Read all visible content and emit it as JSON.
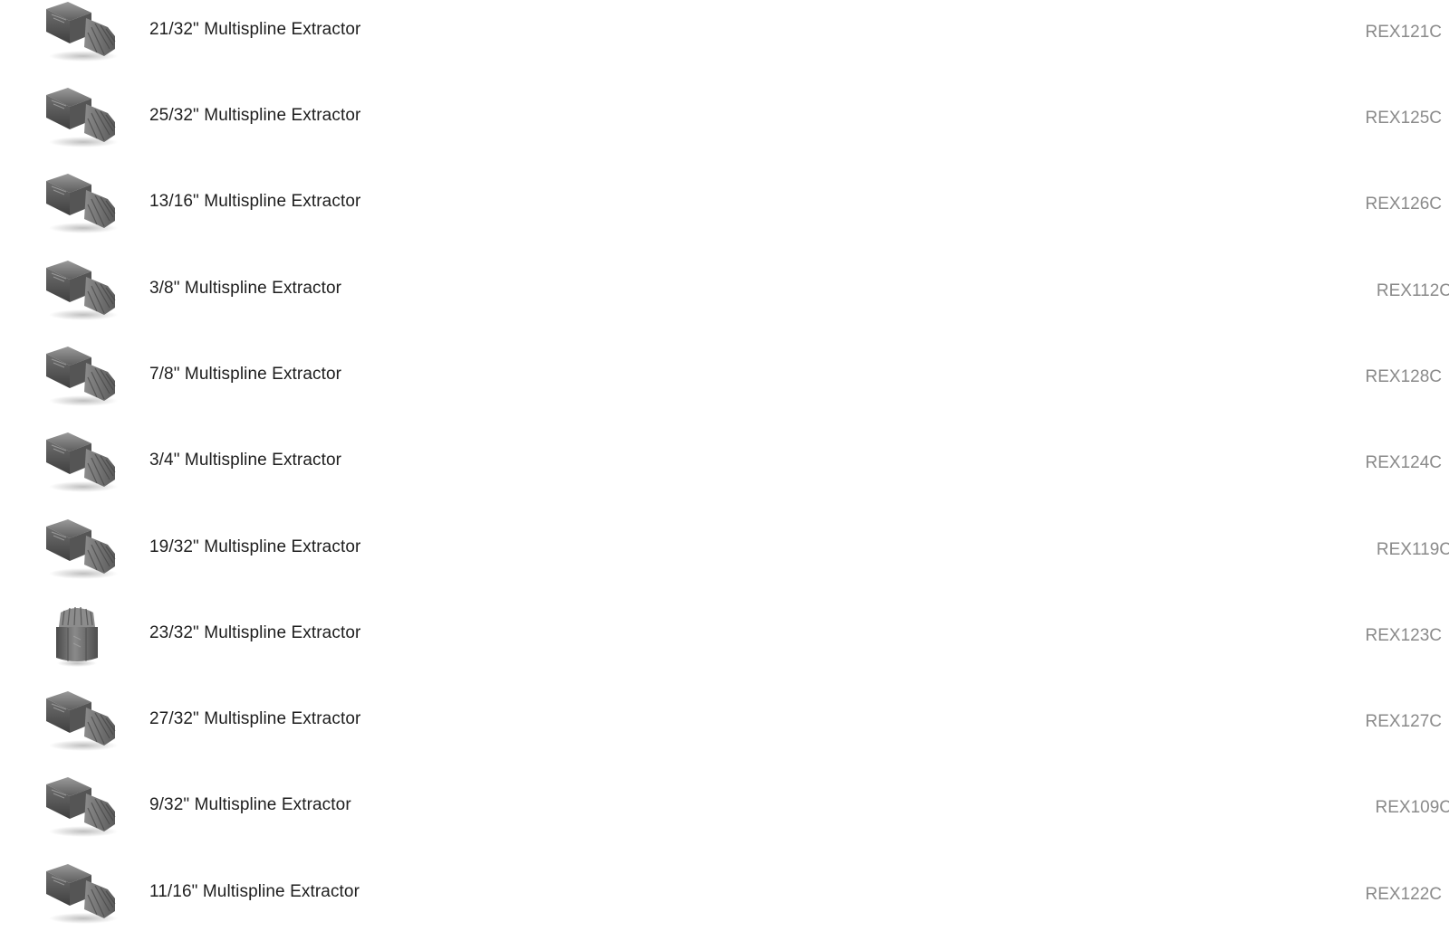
{
  "products": [
    {
      "name": "21/32\" Multispline Extractor",
      "sku": "REX121C",
      "icon": "extractor-side-icon"
    },
    {
      "name": "25/32\" Multispline Extractor",
      "sku": "REX125C",
      "icon": "extractor-side-icon"
    },
    {
      "name": "13/16\" Multispline Extractor",
      "sku": "REX126C",
      "icon": "extractor-side-icon"
    },
    {
      "name": "3/8\" Multispline Extractor",
      "sku": "REX112C",
      "icon": "extractor-side-icon"
    },
    {
      "name": "7/8\" Multispline Extractor",
      "sku": "REX128C",
      "icon": "extractor-side-icon"
    },
    {
      "name": "3/4\" Multispline Extractor",
      "sku": "REX124C",
      "icon": "extractor-side-icon"
    },
    {
      "name": "19/32\" Multispline Extractor",
      "sku": "REX119C",
      "icon": "extractor-side-icon"
    },
    {
      "name": "23/32\" Multispline Extractor",
      "sku": "REX123C",
      "icon": "extractor-upright-icon"
    },
    {
      "name": "27/32\" Multispline Extractor",
      "sku": "REX127C",
      "icon": "extractor-side-icon"
    },
    {
      "name": "9/32\" Multispline Extractor",
      "sku": "REX109C",
      "icon": "extractor-side-icon"
    },
    {
      "name": "11/16\" Multispline Extractor",
      "sku": "REX122C",
      "icon": "extractor-side-icon"
    }
  ],
  "colors": {
    "name_text": "#1e1e1e",
    "sku_text": "#8a8a8a",
    "tool_metal": "#6b6b6b"
  }
}
